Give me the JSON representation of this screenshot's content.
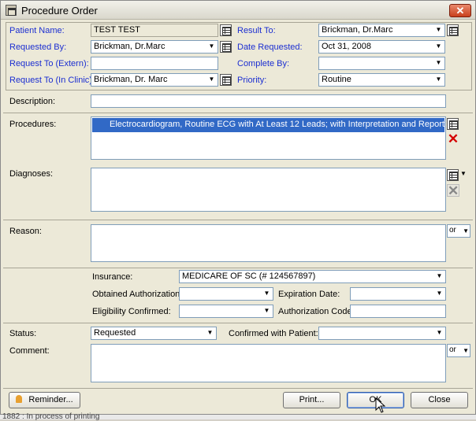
{
  "window": {
    "title": "Procedure Order",
    "close_glyph": "✕"
  },
  "header": {
    "patient_name_label": "Patient Name:",
    "patient_name_value": "TEST TEST",
    "requested_by_label": "Requested By:",
    "requested_by_value": "Brickman, Dr.Marc",
    "request_to_extern_label": "Request To (Extern):",
    "request_to_extern_value": "",
    "request_to_clinic_label": "Request To (In Clinic):",
    "request_to_clinic_value": "Brickman, Dr. Marc",
    "result_to_label": "Result To:",
    "result_to_value": "Brickman, Dr.Marc",
    "date_requested_label": "Date Requested:",
    "date_requested_value": "Oct 31, 2008",
    "complete_by_label": "Complete By:",
    "complete_by_value": "",
    "priority_label": "Priority:",
    "priority_value": "Routine"
  },
  "description": {
    "label": "Description:",
    "value": ""
  },
  "procedures": {
    "label": "Procedures:",
    "items": [
      "Electrocardiogram, Routine ECG with At Least 12 Leads; with Interpretation and Report"
    ]
  },
  "diagnoses": {
    "label": "Diagnoses:",
    "items": []
  },
  "reason": {
    "label": "Reason:",
    "dropdown": "or"
  },
  "insurance": {
    "insurance_label": "Insurance:",
    "insurance_value": "MEDICARE OF SC (# 124567897)",
    "obtained_auth_label": "Obtained Authorization:",
    "obtained_auth_value": "",
    "expiration_label": "Expiration Date:",
    "expiration_value": "",
    "eligibility_label": "Eligibility Confirmed:",
    "eligibility_value": "",
    "auth_code_label": "Authorization Code:",
    "auth_code_value": ""
  },
  "status": {
    "status_label": "Status:",
    "status_value": "Requested",
    "confirmed_label": "Confirmed with Patient:",
    "confirmed_value": ""
  },
  "comment": {
    "label": "Comment:",
    "dropdown": "or"
  },
  "buttons": {
    "reminder": "Reminder...",
    "print": "Print...",
    "ok": "OK",
    "close": "Close"
  },
  "background_text": "1882 : In process of printing",
  "icons": {
    "lookup": "list-lookup-icon",
    "delete": "red-x-icon",
    "dropdown": "▼"
  }
}
